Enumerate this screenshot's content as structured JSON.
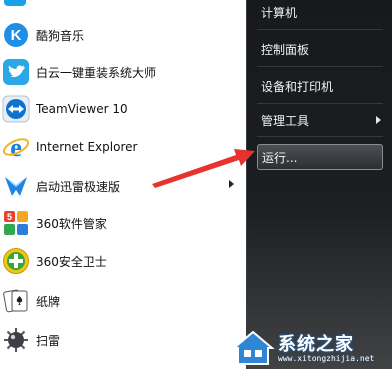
{
  "left_panel": {
    "programs": [
      {
        "label": "酷狗音乐",
        "icon": "kugou-music-icon"
      },
      {
        "label": "白云一键重装系统大师",
        "icon": "twitter-bird-icon"
      },
      {
        "label": "TeamViewer 10",
        "icon": "teamviewer-icon"
      },
      {
        "label": "Internet Explorer",
        "icon": "internet-explorer-icon"
      },
      {
        "label": "启动迅雷极速版",
        "icon": "xunlei-thunder-icon",
        "has_submenu": true
      },
      {
        "label": "360软件管家",
        "icon": "360-software-manager-icon"
      },
      {
        "label": "360安全卫士",
        "icon": "360-safeguard-icon"
      },
      {
        "label": "纸牌",
        "icon": "solitaire-cards-icon"
      },
      {
        "label": "扫雷",
        "icon": "minesweeper-mine-icon"
      }
    ]
  },
  "right_panel": {
    "items": [
      {
        "label": "计算机"
      },
      {
        "label": "控制面板"
      },
      {
        "label": "设备和打印机"
      },
      {
        "label": "管理工具",
        "has_submenu": true
      },
      {
        "label": "运行...",
        "highlighted": true
      }
    ]
  },
  "watermark": {
    "text": "系统之家",
    "url": "www.xitongzhijia.net"
  },
  "colors": {
    "right_panel_bg": "#1b1d20",
    "annotation_arrow": "#e8322e",
    "left_panel_bg": "#ffffff"
  }
}
